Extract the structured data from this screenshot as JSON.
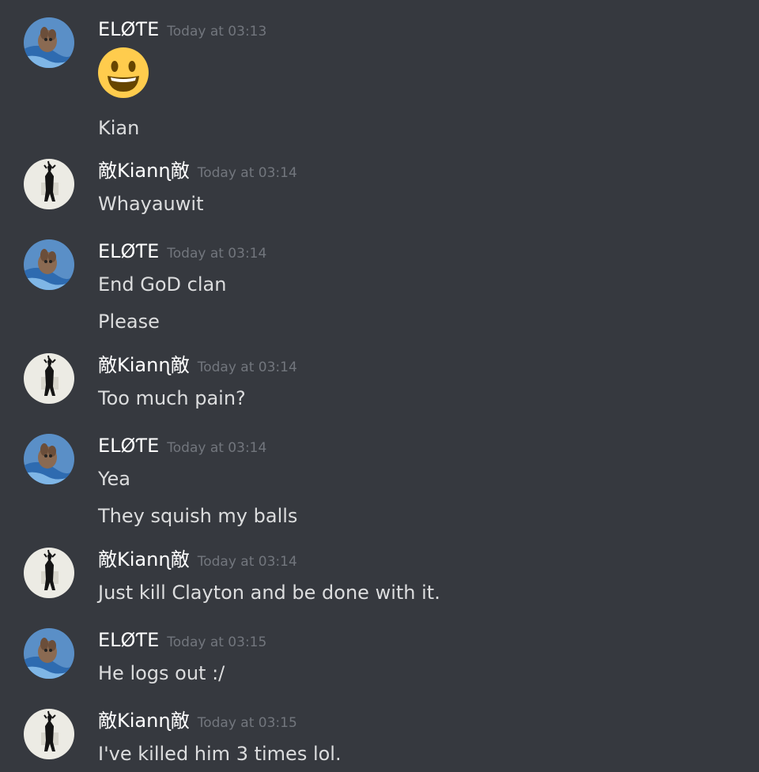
{
  "messages": [
    {
      "author": "ELØƬE",
      "avatar": "dog-avatar",
      "timestamp": "Today at 03:13",
      "emoji": "smiley-emoji",
      "lines": [
        "Kian"
      ]
    },
    {
      "author": "敵Kianɳ敵",
      "avatar": "figure-avatar",
      "timestamp": "Today at 03:14",
      "lines": [
        "Whayauwit"
      ]
    },
    {
      "author": "ELØƬE",
      "avatar": "dog-avatar",
      "timestamp": "Today at 03:14",
      "lines": [
        "End GoD clan",
        "Please"
      ]
    },
    {
      "author": "敵Kianɳ敵",
      "avatar": "figure-avatar",
      "timestamp": "Today at 03:14",
      "lines": [
        "Too much pain?"
      ]
    },
    {
      "author": "ELØƬE",
      "avatar": "dog-avatar",
      "timestamp": "Today at 03:14",
      "lines": [
        "Yea",
        "They squish my balls"
      ]
    },
    {
      "author": "敵Kianɳ敵",
      "avatar": "figure-avatar",
      "timestamp": "Today at 03:14",
      "lines": [
        "Just kill Clayton and be done with it."
      ]
    },
    {
      "author": "ELØƬE",
      "avatar": "dog-avatar",
      "timestamp": "Today at 03:15",
      "lines": [
        "He logs out :/"
      ]
    },
    {
      "author": "敵Kianɳ敵",
      "avatar": "figure-avatar",
      "timestamp": "Today at 03:15",
      "lines": [
        "I've killed him 3 times lol."
      ]
    }
  ],
  "colors": {
    "background": "#36393f",
    "username": "#ffffff",
    "timestamp": "#72767d",
    "message_text": "#dcddde",
    "emoji_yellow": "#ffcc4d"
  }
}
